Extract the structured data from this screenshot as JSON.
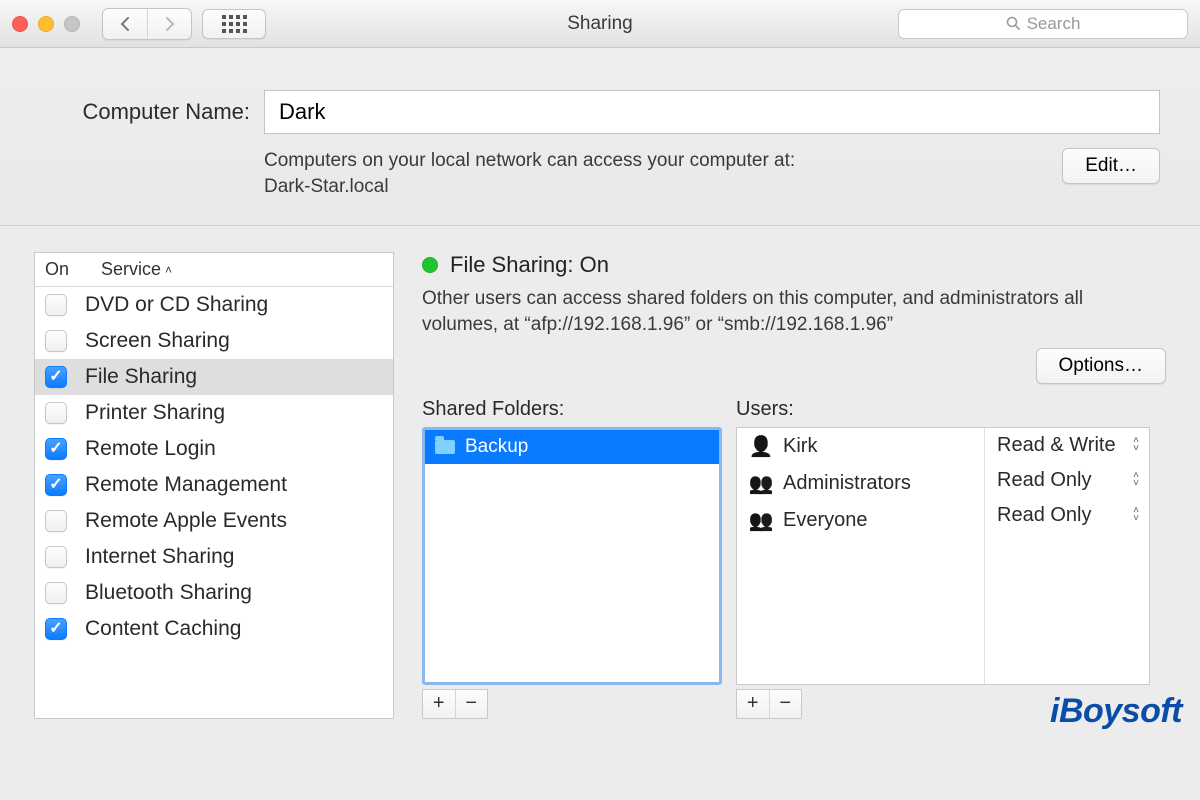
{
  "window": {
    "title": "Sharing"
  },
  "search": {
    "placeholder": "Search"
  },
  "name_section": {
    "label": "Computer Name:",
    "value": "Dark",
    "desc_line1": "Computers on your local network can access your computer at:",
    "desc_line2": "Dark-Star.local",
    "edit_label": "Edit…"
  },
  "services": {
    "col_on": "On",
    "col_service": "Service",
    "items": [
      {
        "label": "DVD or CD Sharing",
        "checked": false,
        "selected": false
      },
      {
        "label": "Screen Sharing",
        "checked": false,
        "selected": false
      },
      {
        "label": "File Sharing",
        "checked": true,
        "selected": true
      },
      {
        "label": "Printer Sharing",
        "checked": false,
        "selected": false
      },
      {
        "label": "Remote Login",
        "checked": true,
        "selected": false
      },
      {
        "label": "Remote Management",
        "checked": true,
        "selected": false
      },
      {
        "label": "Remote Apple Events",
        "checked": false,
        "selected": false
      },
      {
        "label": "Internet Sharing",
        "checked": false,
        "selected": false
      },
      {
        "label": "Bluetooth Sharing",
        "checked": false,
        "selected": false
      },
      {
        "label": "Content Caching",
        "checked": true,
        "selected": false
      }
    ]
  },
  "detail": {
    "status_title": "File Sharing: On",
    "status_desc": "Other users can access shared folders on this computer, and administrators all volumes, at “afp://192.168.1.96” or “smb://192.168.1.96”",
    "options_label": "Options…",
    "shared_folders_title": "Shared Folders:",
    "folders": [
      {
        "name": "Backup"
      }
    ],
    "users_title": "Users:",
    "users": [
      {
        "name": "Kirk",
        "icon": "person",
        "perm": "Read & Write"
      },
      {
        "name": "Administrators",
        "icon": "people-pair",
        "perm": "Read Only"
      },
      {
        "name": "Everyone",
        "icon": "people-many",
        "perm": "Read Only"
      }
    ]
  },
  "glyphs": {
    "plus": "+",
    "minus": "−"
  },
  "watermark": "iBoysoft"
}
